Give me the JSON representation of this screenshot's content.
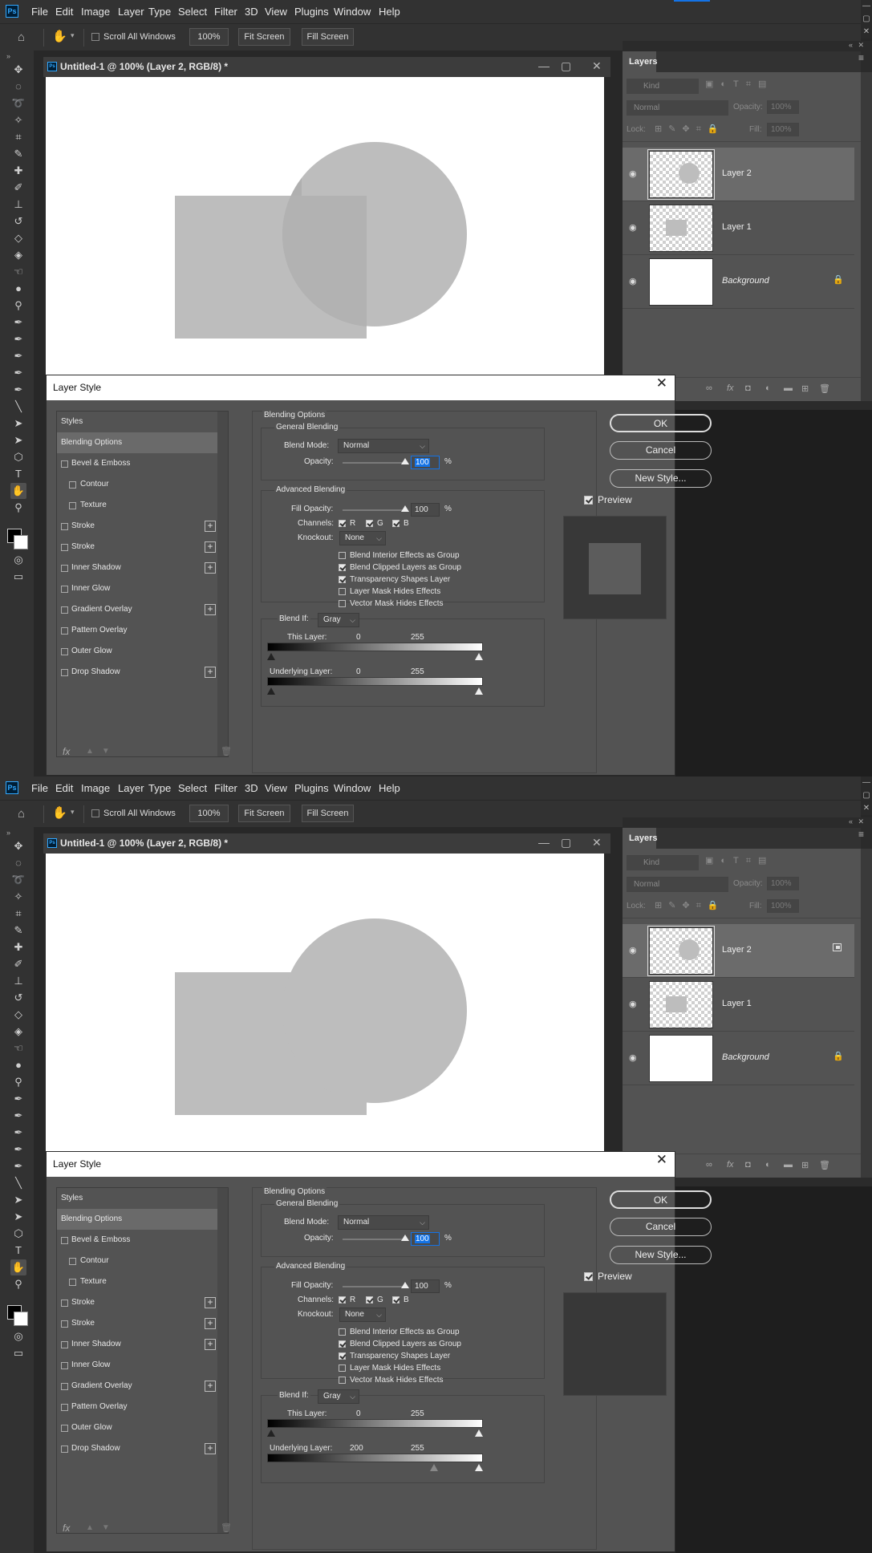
{
  "menu": [
    "File",
    "Edit",
    "Image",
    "Layer",
    "Type",
    "Select",
    "Filter",
    "3D",
    "View",
    "Plugins",
    "Window",
    "Help"
  ],
  "app_logo": "Ps",
  "options_bar": {
    "scroll_all_label": "Scroll All Windows",
    "zoom": "100%",
    "fit_screen": "Fit Screen",
    "fill_screen": "Fill Screen"
  },
  "document": {
    "tab_title": "Untitled-1 @ 100% (Layer 2, RGB/8) *",
    "shape_color": "#bdbdbd"
  },
  "layers_panel": {
    "title": "Layers",
    "kind_placeholder": "Kind",
    "blend_mode": "Normal",
    "opacity_label": "Opacity:",
    "opacity_value": "100%",
    "lock_label": "Lock:",
    "fill_label": "Fill:",
    "fill_value": "100%",
    "layers": [
      {
        "name": "Layer 2"
      },
      {
        "name": "Layer 1"
      },
      {
        "name": "Background"
      }
    ]
  },
  "dialog": {
    "title": "Layer Style",
    "styles_header": "Styles",
    "style_items": [
      {
        "label": "Blending Options"
      },
      {
        "label": "Bevel & Emboss"
      },
      {
        "label": "Contour"
      },
      {
        "label": "Texture"
      },
      {
        "label": "Stroke"
      },
      {
        "label": "Stroke"
      },
      {
        "label": "Inner Shadow"
      },
      {
        "label": "Inner Glow"
      },
      {
        "label": "Gradient Overlay"
      },
      {
        "label": "Pattern Overlay"
      },
      {
        "label": "Outer Glow"
      },
      {
        "label": "Drop Shadow"
      }
    ],
    "fx_label": "fx",
    "blending_options_title": "Blending Options",
    "general_blending_title": "General Blending",
    "blend_mode_label": "Blend Mode:",
    "blend_mode_value": "Normal",
    "opacity_label": "Opacity:",
    "opacity_value": "100",
    "percent": "%",
    "advanced_blending_title": "Advanced Blending",
    "fill_opacity_label": "Fill Opacity:",
    "fill_opacity_value": "100",
    "channels_label": "Channels:",
    "channel_r": "R",
    "channel_g": "G",
    "channel_b": "B",
    "knockout_label": "Knockout:",
    "knockout_value": "None",
    "adv_options": [
      {
        "label": "Blend Interior Effects as Group",
        "checked": false
      },
      {
        "label": "Blend Clipped Layers as Group",
        "checked": true
      },
      {
        "label": "Transparency Shapes Layer",
        "checked": true
      },
      {
        "label": "Layer Mask Hides Effects",
        "checked": false
      },
      {
        "label": "Vector Mask Hides Effects",
        "checked": false
      }
    ],
    "blend_if_label": "Blend If:",
    "blend_if_value": "Gray",
    "this_layer_label": "This Layer:",
    "underlying_layer_label": "Underlying Layer:",
    "buttons": {
      "ok": "OK",
      "cancel": "Cancel",
      "new_style": "New Style..."
    },
    "preview_label": "Preview"
  },
  "states": [
    {
      "this_layer_low": "0",
      "this_layer_high": "255",
      "underlying_low": "0",
      "underlying_high": "255",
      "underlying_low_fraction": 0.0,
      "preview_square_visible": true,
      "circle_overlap_visible": true,
      "layer2_badge": false
    },
    {
      "this_layer_low": "0",
      "this_layer_high": "255",
      "underlying_low": "200",
      "underlying_high": "255",
      "underlying_low_fraction": 0.784,
      "preview_square_visible": false,
      "circle_overlap_visible": false,
      "layer2_badge": true
    }
  ]
}
